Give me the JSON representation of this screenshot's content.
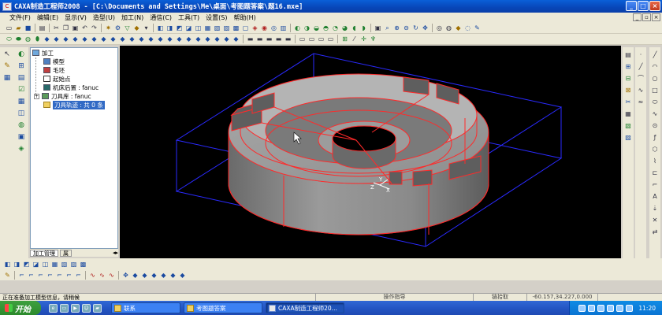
{
  "window": {
    "title": "CAXA制造工程师2008  - [C:\\Documents and Settings\\Me\\桌面\\考图题答案\\题16.mxe]",
    "app_icon": "CAXA"
  },
  "menu": [
    "文件(F)",
    "编辑(E)",
    "显示(V)",
    "造型(U)",
    "加工(N)",
    "通信(C)",
    "工具(T)",
    "设置(S)",
    "帮助(H)"
  ],
  "tree": {
    "root": "加工",
    "items": [
      {
        "label": "模型",
        "icon": "model-icon"
      },
      {
        "label": "毛坯",
        "icon": "blank-icon"
      },
      {
        "label": "起始点",
        "icon": "start-point-icon"
      },
      {
        "label": "机床后置 : fanuc",
        "icon": "machine-post-icon"
      },
      {
        "label": "刀具库 : fanuc",
        "icon": "tool-library-icon"
      },
      {
        "label": "刀具轨迹 : 共 0 条",
        "icon": "toolpath-folder-icon",
        "selected": true
      }
    ],
    "tabs": [
      "加工管理",
      "属"
    ]
  },
  "viewport": {
    "background": "#000000",
    "edge_color": "#ff2a2a",
    "box_color": "#2a2aff",
    "surface_color": "#8a8a8a",
    "axis_labels": [
      "Y",
      "X",
      "Z"
    ]
  },
  "status": {
    "left": "正在准备加工模型信息，请稍候",
    "center": "操作指导",
    "picker": "链拾取",
    "coords": "-60.157,34.227,0.000"
  },
  "taskbar": {
    "start": "开始",
    "tasks": [
      {
        "label": "联系",
        "active": false
      },
      {
        "label": "考图题答案",
        "active": false
      },
      {
        "label": "CAXA制造工程师20...",
        "active": true
      }
    ],
    "clock": "11:20"
  }
}
